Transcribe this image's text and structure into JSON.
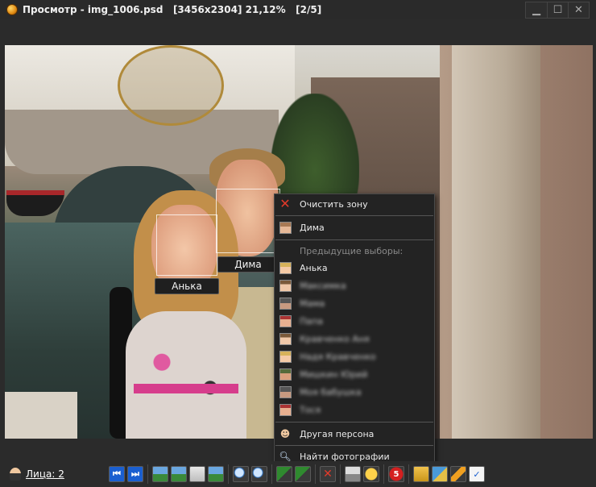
{
  "window": {
    "title": "Просмотр - img_1006.psd   [3456x2304] 21,12%   [2/5]",
    "controls": [
      "minimize-icon",
      "maximize-icon",
      "close-icon"
    ]
  },
  "photo": {
    "face_labels": [
      {
        "name": "Анька"
      },
      {
        "name": "Дима"
      }
    ]
  },
  "context_menu": {
    "clear_zone": "Очистить зону",
    "current_person": "Дима",
    "previous_header": "Предыдущие выборы:",
    "previous_items": [
      {
        "label": "Анька",
        "blurred": false
      },
      {
        "label": "Максимка",
        "blurred": true
      },
      {
        "label": "Мама",
        "blurred": true
      },
      {
        "label": "Папа",
        "blurred": true
      },
      {
        "label": "Кравченко Аня",
        "blurred": true
      },
      {
        "label": "Надя Кравченко",
        "blurred": true
      },
      {
        "label": "Мишкин Юрий",
        "blurred": true
      },
      {
        "label": "Моя бабушка",
        "blurred": true
      },
      {
        "label": "Тося",
        "blurred": true
      }
    ],
    "other_person": "Другая персона",
    "find_photos": "Найти фотографии"
  },
  "bottombar": {
    "faces_link": "Лица: 2",
    "badge_number": "5",
    "colors": {
      "accent": "#1a5fd0",
      "danger": "#e23a2a"
    }
  }
}
